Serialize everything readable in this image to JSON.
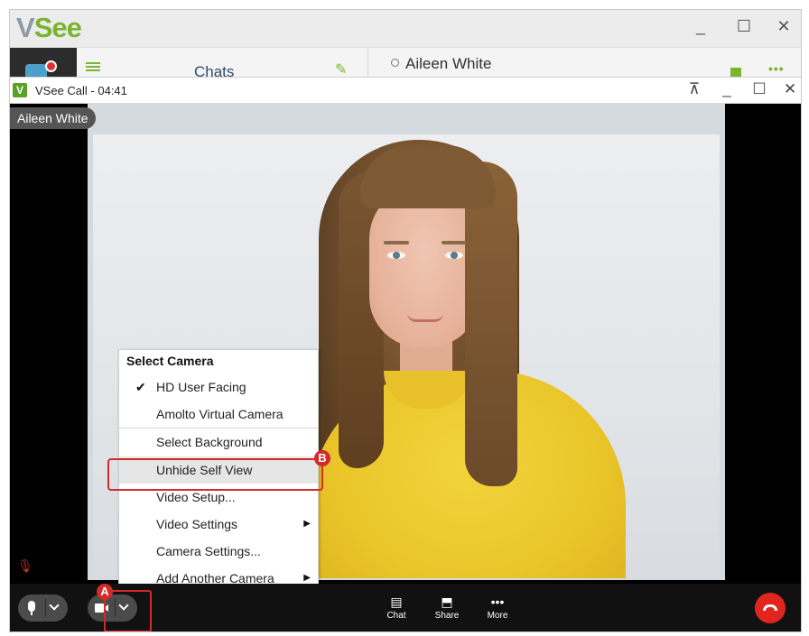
{
  "app": {
    "logo_v": "V",
    "logo_see": "See",
    "minimize": "_",
    "maximize": "☐",
    "close": "✕",
    "chats_label": "Chats",
    "contact_name": "Aileen White",
    "more": "•••"
  },
  "call": {
    "title": "VSee Call - 04:41",
    "logo": "V",
    "pin": "⊼",
    "minimize": "_",
    "maximize": "☐",
    "close": "✕",
    "participant": "Aileen White"
  },
  "menu": {
    "header": "Select Camera",
    "items": [
      {
        "label": "HD User Facing",
        "checked": true
      },
      {
        "label": "Amolto Virtual Camera"
      },
      {
        "label": "Select Background"
      },
      {
        "label": "Unhide Self View"
      },
      {
        "label": "Video Setup..."
      },
      {
        "label": "Video Settings",
        "submenu": true
      },
      {
        "label": "Camera Settings..."
      },
      {
        "label": "Add Another Camera",
        "submenu": true
      }
    ],
    "check": "✔",
    "arrow": "▶"
  },
  "annotations": {
    "a": "A",
    "b": "B",
    "color": "#d42a2a"
  },
  "toolbar": {
    "chat": "Chat",
    "share": "Share",
    "more": "More",
    "more_icon": "•••"
  },
  "colors": {
    "brand_green": "#7bb52e",
    "end_call": "#e0251f"
  }
}
